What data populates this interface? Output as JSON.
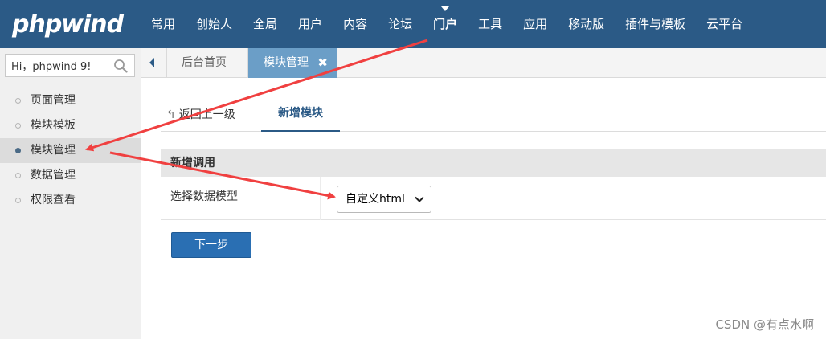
{
  "brand": {
    "logo_text": "phpwind"
  },
  "topnav": {
    "items": [
      {
        "label": "常用"
      },
      {
        "label": "创始人"
      },
      {
        "label": "全局"
      },
      {
        "label": "用户"
      },
      {
        "label": "内容"
      },
      {
        "label": "论坛"
      },
      {
        "label": "门户"
      },
      {
        "label": "工具"
      },
      {
        "label": "应用"
      },
      {
        "label": "移动版"
      },
      {
        "label": "插件与模板"
      },
      {
        "label": "云平台"
      }
    ],
    "active": "门户"
  },
  "sidebar": {
    "search_value": "Hi，phpwind 9!",
    "items": [
      {
        "label": "页面管理"
      },
      {
        "label": "模块模板"
      },
      {
        "label": "模块管理"
      },
      {
        "label": "数据管理"
      },
      {
        "label": "权限查看"
      }
    ],
    "active": "模块管理"
  },
  "tabs": {
    "home_label": "后台首页",
    "current_label": "模块管理",
    "close_glyph": "✖"
  },
  "subnav": {
    "back_label": "返回上一级",
    "active_label": "新增模块"
  },
  "form": {
    "section_title": "新增调用",
    "field_label": "选择数据模型",
    "select_value": "自定义html",
    "next_button": "下一步"
  },
  "watermark": "CSDN @有点水啊",
  "colors": {
    "topbar": "#2b5a86",
    "active_tab": "#6b9ec7",
    "button": "#2a6fb3",
    "annotation_arrow": "#f04040"
  },
  "icons": {
    "search": "search-icon",
    "back_arrow": "back-arrow-icon",
    "select_chevron": "chevron-down-icon",
    "tab_back": "triangle-left-icon",
    "nav_caret": "caret-down-icon"
  }
}
